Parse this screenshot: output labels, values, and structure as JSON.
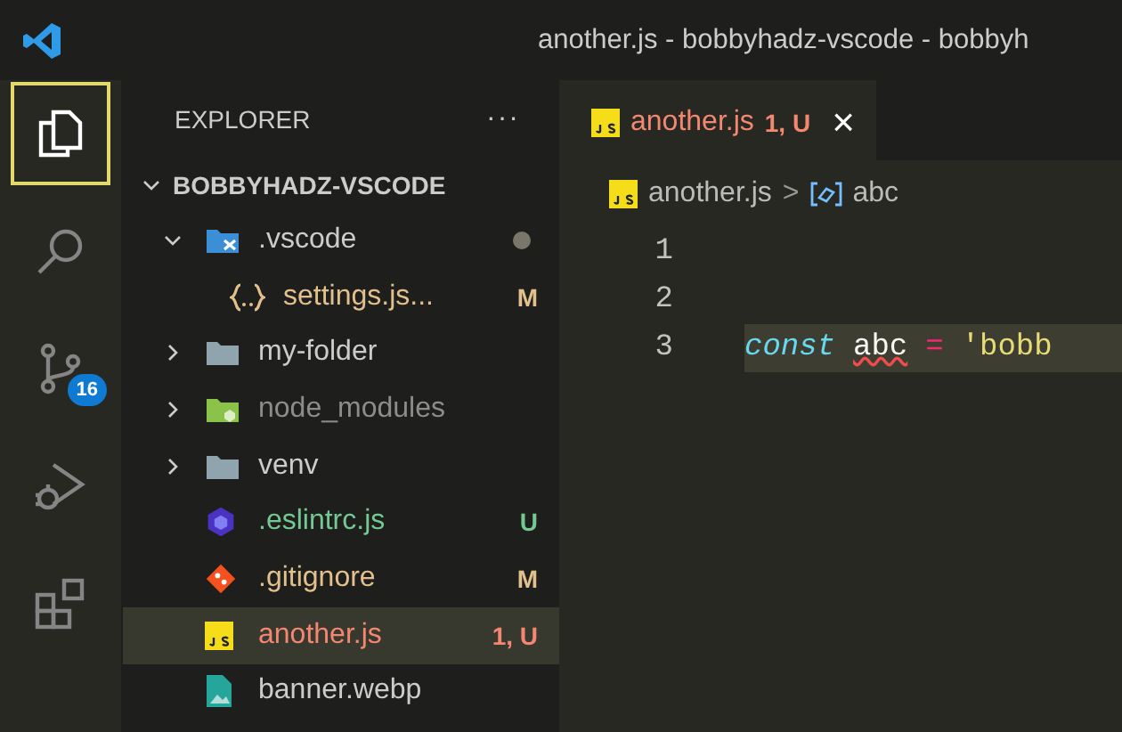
{
  "window": {
    "title": "another.js - bobbyhadz-vscode - bobbyh"
  },
  "activity_bar": [
    {
      "kind": "explorer",
      "selected": true
    },
    {
      "kind": "search",
      "selected": false
    },
    {
      "kind": "source-control",
      "selected": false,
      "badge": "16"
    },
    {
      "kind": "run",
      "selected": false
    },
    {
      "kind": "extensions",
      "selected": false
    }
  ],
  "sidebar": {
    "title": "EXPLORER",
    "more": "···",
    "root": {
      "label": "BOBBYHADZ-VSCODE",
      "expanded": true,
      "children": [
        {
          "label": ".vscode",
          "kind": "folder-vscode",
          "expanded": true,
          "dirty": true,
          "children": [
            {
              "label": "settings.js...",
              "kind": "json",
              "color": "#e2c08d",
              "decoration": "M"
            }
          ]
        },
        {
          "label": "my-folder",
          "kind": "folder",
          "expanded": false
        },
        {
          "label": "node_modules",
          "kind": "folder-node",
          "expanded": false,
          "color": "#8c8c8c"
        },
        {
          "label": "venv",
          "kind": "folder",
          "expanded": false
        },
        {
          "label": ".eslintrc.js",
          "kind": "eslint",
          "color": "#73c991",
          "decoration": "U"
        },
        {
          "label": ".gitignore",
          "kind": "git",
          "color": "#e2c08d",
          "decoration": "M"
        },
        {
          "label": "another.js",
          "kind": "js",
          "color": "#f48771",
          "decoration": "1, U",
          "selected": true
        },
        {
          "label": "banner.webp",
          "kind": "image"
        }
      ]
    }
  },
  "tabs": [
    {
      "label": "another.js",
      "color": "#f48771",
      "decoration": "1, U",
      "close": "×",
      "selected": true
    }
  ],
  "breadcrumb": {
    "file": "another.js",
    "separator": ">",
    "symbol": "abc"
  },
  "editor": {
    "lines": [
      {
        "number": "1"
      },
      {
        "number": "2"
      },
      {
        "number": "3",
        "highlighted": true,
        "tokens": [
          {
            "text": "const",
            "kind": "keyword"
          },
          {
            "text": "abc",
            "kind": "variable",
            "error": true
          },
          {
            "text": "=",
            "kind": "operator"
          },
          {
            "text": "'bobb",
            "kind": "string"
          }
        ]
      }
    ]
  }
}
